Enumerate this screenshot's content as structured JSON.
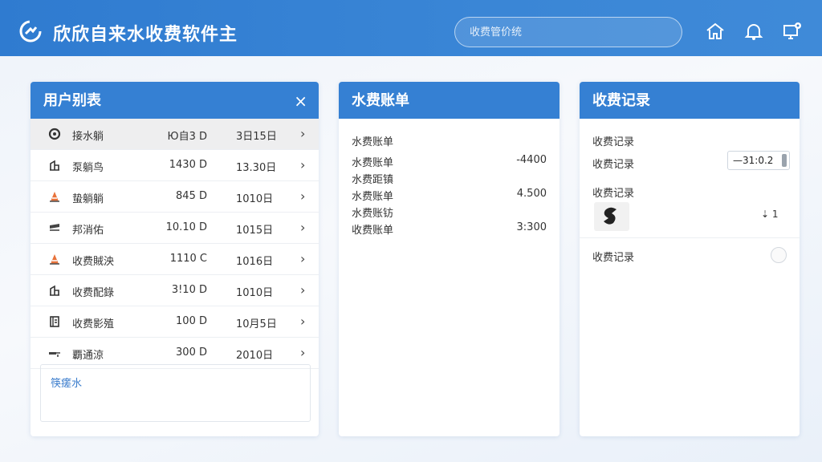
{
  "header": {
    "title": "欣欣自来水收费软件主",
    "search_placeholder": "收费管价统",
    "icons": [
      "home-icon",
      "bell-icon",
      "monitor-settings-icon"
    ]
  },
  "users_panel": {
    "title": "用户别表",
    "close_label": "×",
    "rows": [
      {
        "icon": "gear-icon",
        "name": "接水躺",
        "amount": "Ю自3 D",
        "date": "3日15日"
      },
      {
        "icon": "building-icon",
        "name": "泵躺鸟",
        "amount": "1430 D",
        "date": "13.30日"
      },
      {
        "icon": "cone-icon",
        "name": "蛰躺躺",
        "amount": "845 D",
        "date": "1010日"
      },
      {
        "icon": "flag-icon",
        "name": "邦消佑",
        "amount": "10.10 D",
        "date": "1015日"
      },
      {
        "icon": "cone-icon",
        "name": "收费賊泱",
        "amount": "1110 C",
        "date": "1016日"
      },
      {
        "icon": "building-icon",
        "name": "收费配錄",
        "amount": "3!10 D",
        "date": "1010日"
      },
      {
        "icon": "book-icon",
        "name": "收费影殖",
        "amount": "100 D",
        "date": "10月5日"
      },
      {
        "icon": "tap-icon",
        "name": "覇通涼",
        "amount": "300 D",
        "date": "2010日"
      }
    ],
    "note": "筷瘥水"
  },
  "bills_panel": {
    "title": "水费账单",
    "lines": [
      "水费账单",
      "水费账单",
      "水费距镇",
      "水费账单",
      "水费账钫",
      "收费账单"
    ],
    "values": [
      "-4400",
      "4.500",
      "3:300"
    ]
  },
  "records_panel": {
    "title": "收费记录",
    "labels": [
      "收费记录",
      "收费记录",
      "收费记录",
      "收费记录"
    ],
    "stepper_value": "—31:0.2",
    "small_value": "⇣ 1",
    "colors": {
      "primary": "#3580d3",
      "header": "#2f7bd0"
    }
  }
}
